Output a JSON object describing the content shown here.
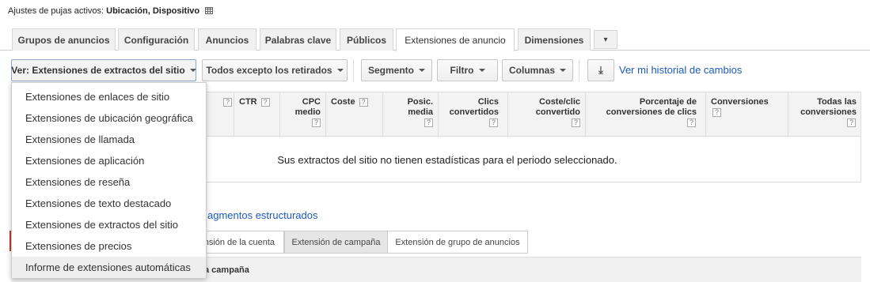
{
  "bid_settings": {
    "prefix": "Ajustes de pujas activos:",
    "value": "Ubicación, Dispositivo"
  },
  "tabs": [
    {
      "label": "Grupos de anuncios"
    },
    {
      "label": "Configuración"
    },
    {
      "label": "Anuncios"
    },
    {
      "label": "Palabras clave"
    },
    {
      "label": "Públicos"
    },
    {
      "label": "Extensiones de anuncio"
    },
    {
      "label": "Dimensiones"
    },
    {
      "label": "▾"
    }
  ],
  "toolbar": {
    "view_label": "Ver: Extensiones de extractos del sitio",
    "status_filter": "Todos excepto los retirados",
    "segment": "Segmento",
    "filter": "Filtro",
    "columns": "Columnas",
    "download_icon": "download-icon",
    "history_link": "Ver mi historial de cambios"
  },
  "table": {
    "columns": [
      {
        "label": "",
        "help": "?"
      },
      {
        "label": "CTR",
        "help": "?"
      },
      {
        "label": "CPC medio",
        "help": "?"
      },
      {
        "label": "Coste",
        "help": "?"
      },
      {
        "label": "Posic. media",
        "help": "?"
      },
      {
        "label": "Clics convertidos",
        "help": "?"
      },
      {
        "label": "Coste/clic convertido",
        "help": "?"
      },
      {
        "label": "Porcentaje de conversiones de clics",
        "help": "?"
      },
      {
        "label": "Conversiones",
        "help": "?"
      },
      {
        "label": "Todas las conversiones",
        "help": "?"
      }
    ],
    "empty_message": "Sus extractos del sitio no tienen estadísticas para el periodo seleccionado."
  },
  "extension_section": {
    "title_partial": "agmentos estructurados"
  },
  "sub_tabs": [
    {
      "label": "nsión de la cuenta"
    },
    {
      "label": "Extensión de campaña"
    },
    {
      "label": "Extensión de grupo de anuncios"
    }
  ],
  "bottom_row": {
    "label": "a campaña"
  },
  "dropdown": {
    "items": [
      "Extensiones de enlaces de sitio",
      "Extensiones de ubicación geográfica",
      "Extensiones de llamada",
      "Extensiones de aplicación",
      "Extensiones de reseña",
      "Extensiones de texto destacado",
      "Extensiones de extractos del sitio",
      "Extensiones de precios",
      "Informe de extensiones automáticas"
    ],
    "highlighted_index": 8
  }
}
